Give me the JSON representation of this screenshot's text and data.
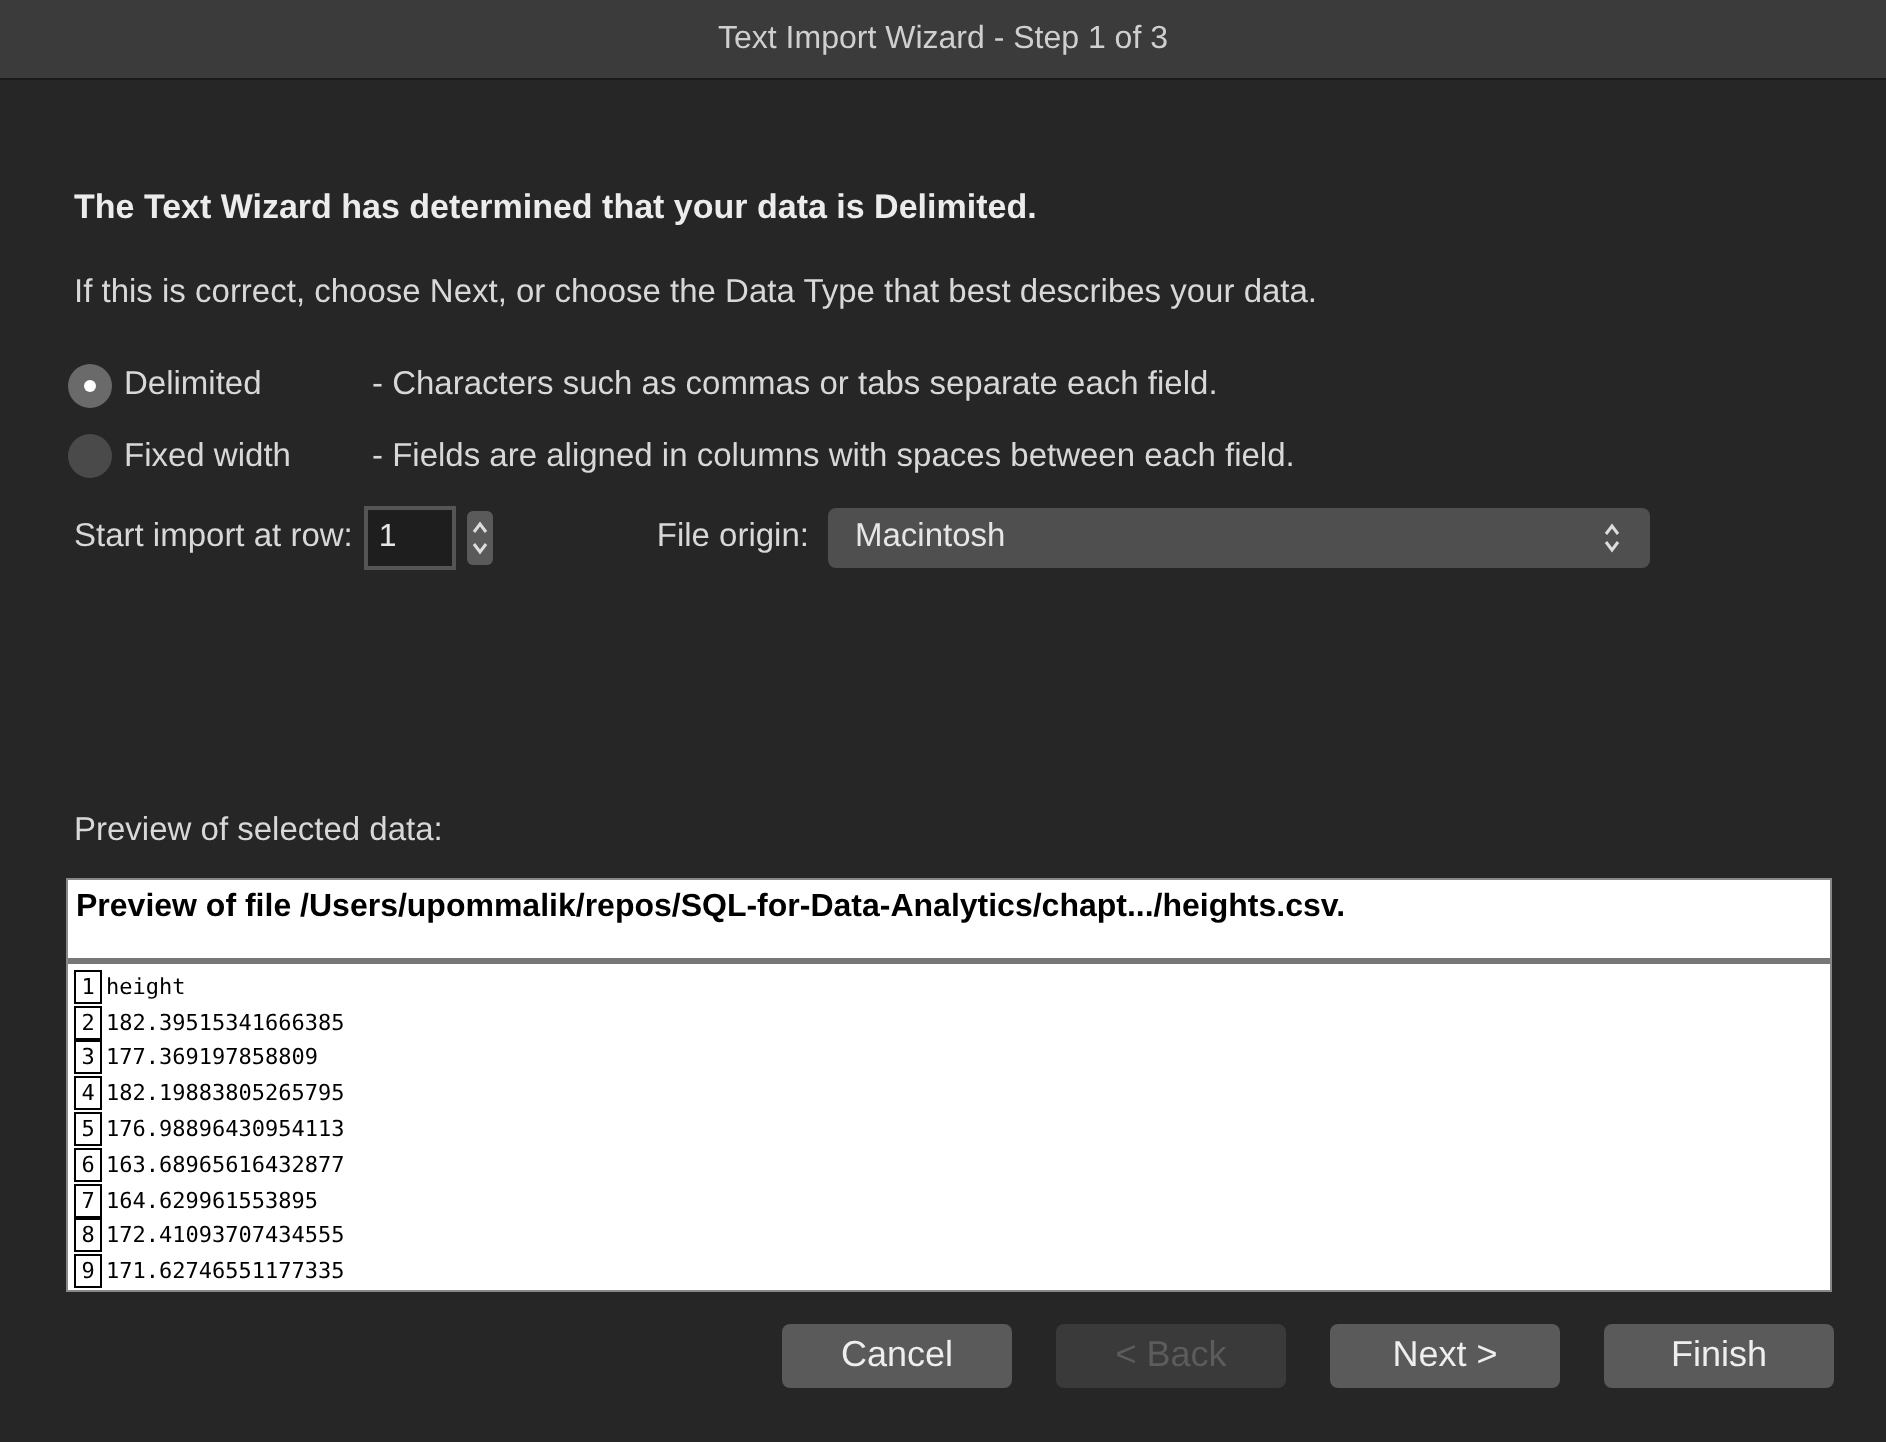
{
  "window": {
    "title": "Text Import Wizard - Step 1 of 3"
  },
  "heading": "The Text Wizard has determined that your data is Delimited.",
  "instruction": "If this is correct, choose Next, or choose the Data Type that best describes your data.",
  "data_types": [
    {
      "label": "Delimited",
      "description": "- Characters such as commas or tabs separate each field.",
      "selected": true
    },
    {
      "label": "Fixed width",
      "description": "- Fields are aligned in columns with spaces between each field.",
      "selected": false
    }
  ],
  "start_row": {
    "label": "Start import at row:",
    "value": "1"
  },
  "file_origin": {
    "label": "File origin:",
    "value": "Macintosh"
  },
  "preview": {
    "label": "Preview of selected data:",
    "header": "Preview of file /Users/upommalik/repos/SQL-for-Data-Analytics/chapt.../heights.csv.",
    "rows": [
      {
        "number": "1",
        "text": "height"
      },
      {
        "number": "2",
        "text": "182.39515341666385"
      },
      {
        "number": "3",
        "text": "177.369197858809"
      },
      {
        "number": "4",
        "text": "182.19883805265795"
      },
      {
        "number": "5",
        "text": "176.98896430954113"
      },
      {
        "number": "6",
        "text": "163.68965616432877"
      },
      {
        "number": "7",
        "text": "164.629961553895"
      },
      {
        "number": "8",
        "text": "172.41093707434555"
      },
      {
        "number": "9",
        "text": "171.62746551177335"
      }
    ]
  },
  "buttons": [
    {
      "label": "Cancel",
      "disabled": false
    },
    {
      "label": "< Back",
      "disabled": true
    },
    {
      "label": "Next >",
      "disabled": false
    },
    {
      "label": "Finish",
      "disabled": false
    }
  ]
}
